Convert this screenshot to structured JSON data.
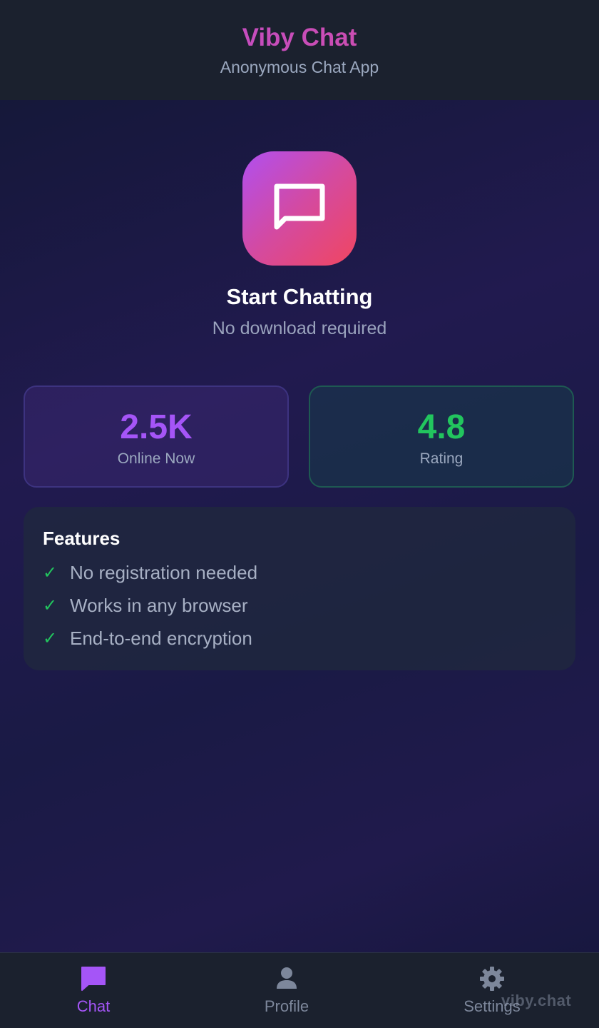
{
  "header": {
    "title": "Viby Chat",
    "subtitle": "Anonymous Chat App"
  },
  "hero": {
    "icon": "chat-bubble-icon",
    "title": "Start Chatting",
    "subtitle": "No download required"
  },
  "stats": {
    "online": {
      "value": "2.5K",
      "label": "Online Now"
    },
    "rating": {
      "value": "4.8",
      "label": "Rating"
    }
  },
  "features": {
    "title": "Features",
    "check_glyph": "✓",
    "items": [
      "No registration needed",
      "Works in any browser",
      "End-to-end encryption"
    ]
  },
  "nav": {
    "chat": {
      "label": "Chat",
      "icon": "chat-icon"
    },
    "profile": {
      "label": "Profile",
      "icon": "user-icon"
    },
    "settings": {
      "label": "Settings",
      "icon": "gear-icon"
    }
  },
  "watermark": "viby.chat",
  "colors": {
    "accent_purple": "#a555f7",
    "accent_green": "#22c55e",
    "header_bg": "#1b212e",
    "muted_text": "#9ba8bf"
  }
}
